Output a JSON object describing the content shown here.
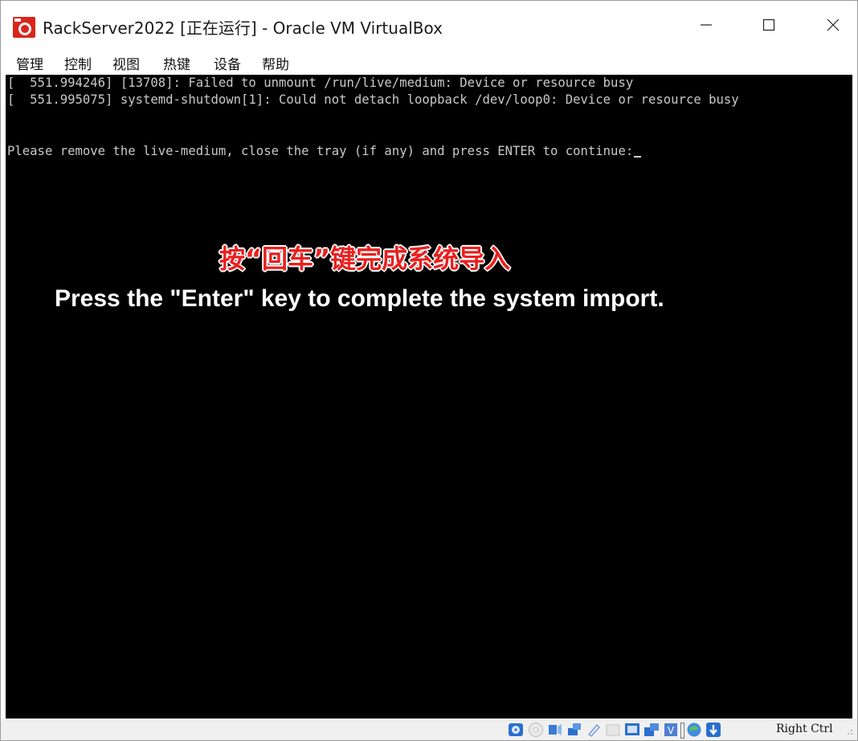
{
  "window": {
    "title": "RackServer2022 [正在运行] - Oracle VM VirtualBox",
    "accent_color": "#e8201f"
  },
  "menu": {
    "items": [
      {
        "label": "管理"
      },
      {
        "label": "控制"
      },
      {
        "label": "视图"
      },
      {
        "label": "热键"
      },
      {
        "label": "设备"
      },
      {
        "label": "帮助"
      }
    ]
  },
  "console": {
    "lines": [
      "[  551.994246] [13708]: Failed to unmount /run/live/medium: Device or resource busy",
      "[  551.995075] systemd-shutdown[1]: Could not detach loopback /dev/loop0: Device or resource busy",
      "",
      "Please remove the live-medium, close the tray (if any) and press ENTER to continue:"
    ]
  },
  "overlay": {
    "cn_text": "按“回车”键完成系统导入",
    "en_text": "Press the \"Enter\" key to complete the system import."
  },
  "statusbar": {
    "icons": [
      "hard-disk-icon",
      "optical-drive-icon",
      "audio-icon",
      "network-icon",
      "usb-icon",
      "shared-folders-icon",
      "display-icon",
      "recording-icon",
      "virtualization-icon",
      "mouse-integration-icon",
      "keyboard-capture-icon"
    ],
    "host_key": "Right Ctrl"
  }
}
